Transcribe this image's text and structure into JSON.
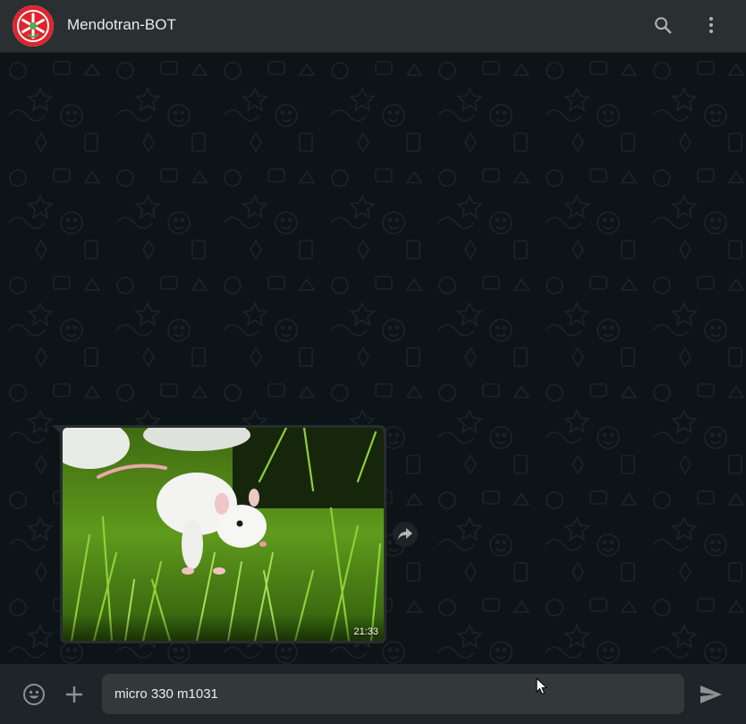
{
  "header": {
    "contact_name": "Mendotran-BOT",
    "avatar_icon": "mendotran-logo-icon",
    "search_icon": "search-icon",
    "menu_icon": "kebab-menu-icon"
  },
  "chat": {
    "messages": [
      {
        "type": "image",
        "image_subject": "white rat in grass photo",
        "time": "21:33",
        "action_icon": "forward-icon"
      }
    ]
  },
  "composer": {
    "emoji_icon": "emoji-icon",
    "attach_icon": "plus-icon",
    "input_value": "micro 330 m1031",
    "send_icon": "send-icon"
  },
  "colors": {
    "header_bg": "#2a2f32",
    "chat_bg": "#0d1418",
    "bubble_bg": "#262d31",
    "footer_bg": "#1e2428",
    "input_bg": "#33383b",
    "icon": "#b1b3b5",
    "logo_red": "#e0242c"
  }
}
